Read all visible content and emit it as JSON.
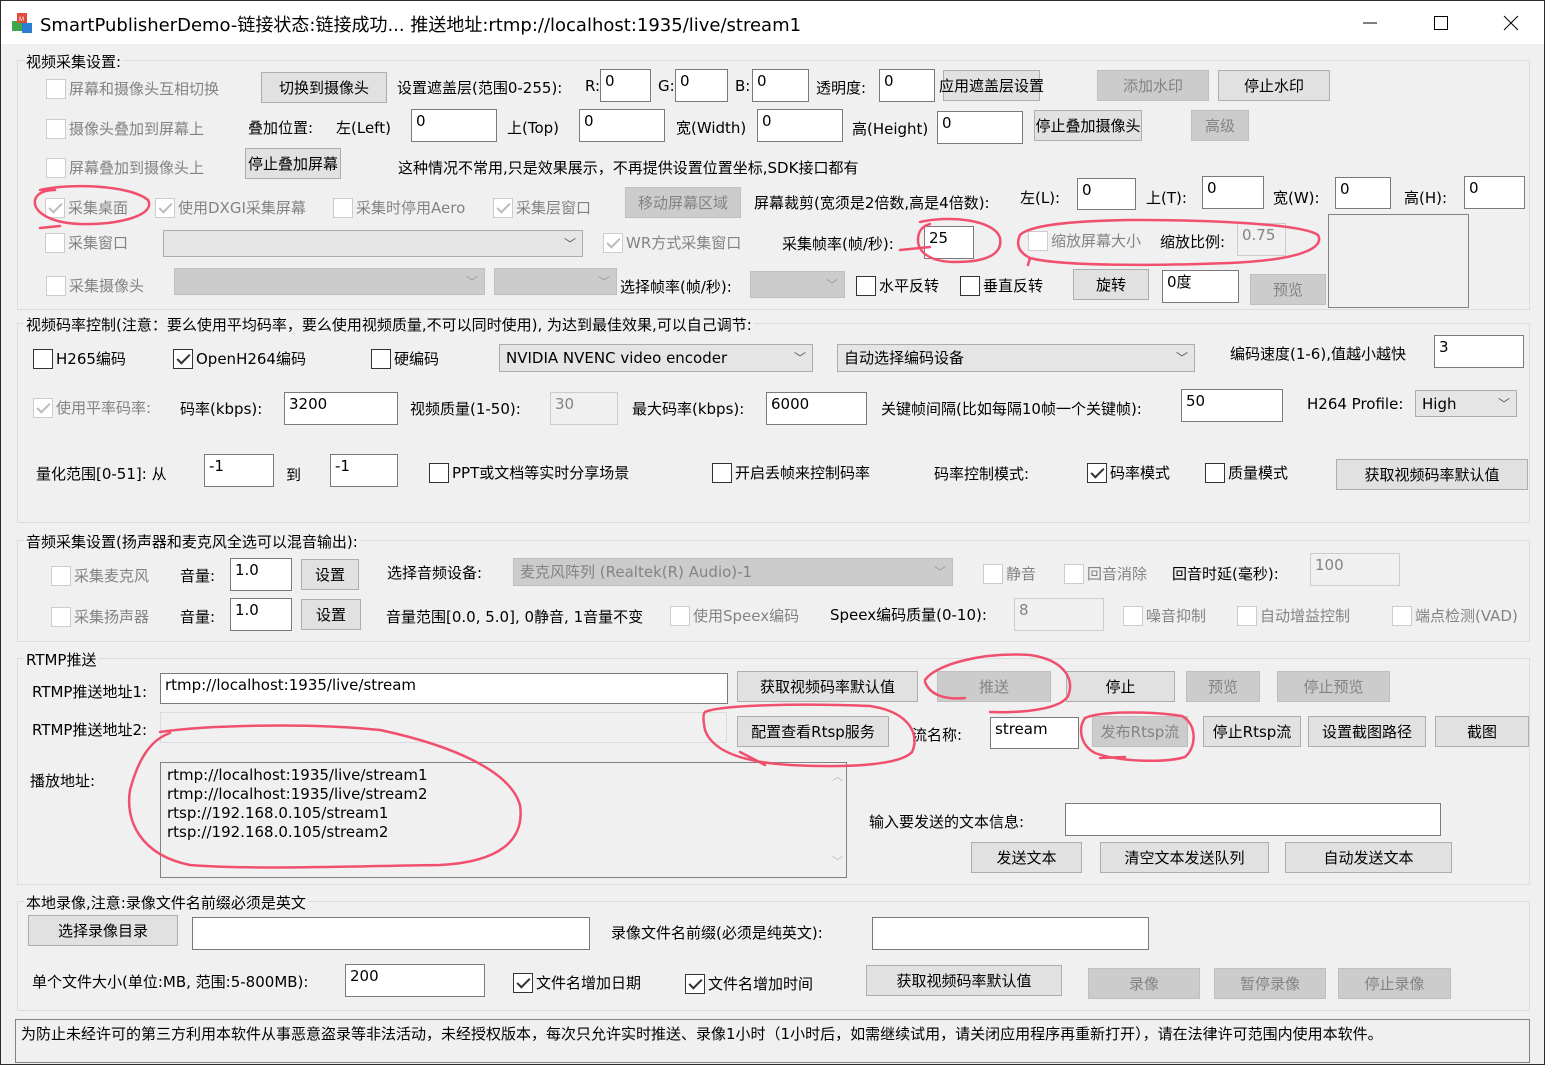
{
  "window": {
    "title": "SmartPublisherDemo-链接状态:链接成功... 推送地址:rtmp://localhost:1935/live/stream1",
    "icon": "app-cubes-icon",
    "controls": {
      "minimize": "minimize-icon",
      "maximize": "maximize-icon",
      "close": "close-icon"
    }
  },
  "video_capture": {
    "group_label": "视频采集设置:",
    "switch_screen_camera": {
      "label": "屏幕和摄像头互相切换",
      "checked": false,
      "enabled": false
    },
    "switch_to_camera_button": "切换到摄像头",
    "mask_label": "设置遮盖层(范围0-255):",
    "r_label": "R:",
    "r_value": "0",
    "g_label": "G:",
    "g_value": "0",
    "b_label": "B:",
    "b_value": "0",
    "alpha_label": "透明度:",
    "alpha_value": "0",
    "apply_mask_button": "应用遮盖层设置",
    "add_watermark_button": "添加水印",
    "stop_watermark_button": "停止水印",
    "camera_overlay_screen": {
      "label": "摄像头叠加到屏幕上",
      "checked": false,
      "enabled": false
    },
    "overlay_pos_label": "叠加位置:",
    "left_label": "左(Left)",
    "left_value": "0",
    "top_label": "上(Top)",
    "top_value": "0",
    "width_label": "宽(Width)",
    "width_value": "0",
    "height_label": "高(Height)",
    "height_value": "0",
    "stop_overlay_camera_button": "停止叠加摄像头",
    "advanced_button": "高级",
    "screen_overlay_camera": {
      "label": "屏幕叠加到摄像头上",
      "checked": false,
      "enabled": false
    },
    "stop_overlay_screen_button": "停止叠加屏幕",
    "overlay_note": "这种情况不常用,只是效果展示，不再提供设置位置坐标,SDK接口都有",
    "capture_desktop": {
      "label": "采集桌面",
      "checked": true,
      "enabled": false
    },
    "use_dxgi": {
      "label": "使用DXGI采集屏幕",
      "checked": true,
      "enabled": false
    },
    "disable_aero": {
      "label": "采集时停用Aero",
      "checked": false,
      "enabled": false
    },
    "capture_layered": {
      "label": "采集层窗口",
      "checked": true,
      "enabled": false
    },
    "move_region_button": "移动屏幕区域",
    "crop_label": "屏幕裁剪(宽须是2倍数,高是4倍数):",
    "crop_left_label": "左(L):",
    "crop_left_value": "0",
    "crop_top_label": "上(T):",
    "crop_top_value": "0",
    "crop_width_label": "宽(W):",
    "crop_width_value": "0",
    "crop_height_label": "高(H):",
    "crop_height_value": "0",
    "capture_window": {
      "label": "采集窗口",
      "checked": false,
      "enabled": false
    },
    "window_select_value": "",
    "wr_capture": {
      "label": "WR方式采集窗口",
      "checked": true,
      "enabled": false
    },
    "fps_label": "采集帧率(帧/秒):",
    "fps_value": "25",
    "scale_screen": {
      "label": "缩放屏幕大小",
      "checked": false,
      "enabled": false
    },
    "scale_ratio_label": "缩放比例:",
    "scale_ratio_value": "0.75",
    "capture_camera": {
      "label": "采集摄像头",
      "checked": false,
      "enabled": false
    },
    "camera_select_value": "",
    "resolution_select_value": "",
    "select_fps_label": "选择帧率(帧/秒):",
    "select_fps_value": "",
    "flip_h": {
      "label": "水平反转",
      "checked": false,
      "enabled": true
    },
    "flip_v": {
      "label": "垂直反转",
      "checked": false,
      "enabled": true
    },
    "rotate_button": "旋转",
    "rotate_value": "0度",
    "preview_button": "预览"
  },
  "bitrate": {
    "group_label": "视频码率控制(注意：要么使用平均码率，要么使用视频质量,不可以同时使用), 为达到最佳效果,可以自己调节:",
    "h265": {
      "label": "H265编码",
      "checked": false,
      "enabled": true
    },
    "openh264": {
      "label": "OpenH264编码",
      "checked": true,
      "enabled": true
    },
    "hw_encode": {
      "label": "硬编码",
      "checked": false,
      "enabled": true
    },
    "encoder_select": "NVIDIA NVENC video encoder",
    "device_select": "自动选择编码设备",
    "speed_label": "编码速度(1-6),值越小越快",
    "speed_value": "3",
    "use_avg_bitrate": {
      "label": "使用平率码率:",
      "checked": true,
      "enabled": false
    },
    "bitrate_label": "码率(kbps):",
    "bitrate_value": "3200",
    "quality_label": "视频质量(1-50):",
    "quality_value": "30",
    "max_bitrate_label": "最大码率(kbps):",
    "max_bitrate_value": "6000",
    "gop_label": "关键帧间隔(比如每隔10帧一个关键帧):",
    "gop_value": "50",
    "profile_label": "H264 Profile:",
    "profile_value": "High",
    "qp_label": "量化范围[0-51]: 从",
    "qp_from": "-1",
    "qp_to_label": "到",
    "qp_to": "-1",
    "ppt_scene": {
      "label": "PPT或文档等实时分享场景",
      "checked": false,
      "enabled": true
    },
    "frame_drop": {
      "label": "开启丢帧来控制码率",
      "checked": false,
      "enabled": true
    },
    "mode_label": "码率控制模式:",
    "bitrate_mode": {
      "label": "码率模式",
      "checked": true,
      "enabled": true
    },
    "quality_mode": {
      "label": "质量模式",
      "checked": false,
      "enabled": true
    },
    "get_default_button": "获取视频码率默认值"
  },
  "audio": {
    "group_label": "音频采集设置(扬声器和麦克风全选可以混音输出):",
    "capture_mic": {
      "label": "采集麦克风",
      "checked": false,
      "enabled": false
    },
    "mic_volume_label": "音量:",
    "mic_volume": "1.0",
    "mic_set_button": "设置",
    "device_label": "选择音频设备:",
    "device_value": "麦克风阵列 (Realtek(R) Audio)-1",
    "mute": {
      "label": "静音",
      "checked": false,
      "enabled": false
    },
    "aec": {
      "label": "回音消除",
      "checked": false,
      "enabled": false
    },
    "echo_delay_label": "回音时延(毫秒):",
    "echo_delay_value": "100",
    "capture_speaker": {
      "label": "采集扬声器",
      "checked": false,
      "enabled": false
    },
    "spk_volume_label": "音量:",
    "spk_volume": "1.0",
    "spk_set_button": "设置",
    "volume_range_note": "音量范围[0.0, 5.0], 0静音, 1音量不变",
    "use_speex": {
      "label": "使用Speex编码",
      "checked": false,
      "enabled": false
    },
    "speex_quality_label": "Speex编码质量(0-10):",
    "speex_quality_value": "8",
    "noise_suppress": {
      "label": "噪音抑制",
      "checked": false,
      "enabled": false
    },
    "agc": {
      "label": "自动增益控制",
      "checked": false,
      "enabled": false
    },
    "vad": {
      "label": "端点检测(VAD)",
      "checked": false,
      "enabled": false
    }
  },
  "rtmp": {
    "group_label": "RTMP推送",
    "url1_label": "RTMP推送地址1:",
    "url1_value": "rtmp://localhost:1935/live/stream",
    "get_default_button": "获取视频码率默认值",
    "push_button": "推送",
    "stop_button": "停止",
    "preview_button": "预览",
    "stop_preview_button": "停止预览",
    "url2_label": "RTMP推送地址2:",
    "url2_value": "",
    "rtsp_config_button": "配置查看Rtsp服务",
    "stream_name_label": "流名称:",
    "stream_name_value": "stream",
    "publish_rtsp_button": "发布Rtsp流",
    "stop_rtsp_button": "停止Rtsp流",
    "snapshot_path_button": "设置截图路径",
    "snapshot_button": "截图",
    "play_urls_label": "播放地址:",
    "play_urls": [
      "rtmp://localhost:1935/live/stream1",
      "rtmp://localhost:1935/live/stream2",
      "rtsp://192.168.0.105/stream1",
      "rtsp://192.168.0.105/stream2"
    ],
    "text_msg_label": "输入要发送的文本信息:",
    "text_msg_value": "",
    "send_text_button": "发送文本",
    "clear_queue_button": "清空文本发送队列",
    "auto_send_button": "自动发送文本"
  },
  "record": {
    "group_label": "本地录像,注意:录像文件名前缀必须是英文",
    "choose_dir_button": "选择录像目录",
    "dir_value": "",
    "prefix_label": "录像文件名前缀(必须是纯英文):",
    "prefix_value": "",
    "file_size_label": "单个文件大小(单位:MB, 范围:5-800MB):",
    "file_size_value": "200",
    "add_date": {
      "label": "文件名增加日期",
      "checked": true,
      "enabled": true
    },
    "add_time": {
      "label": "文件名增加时间",
      "checked": true,
      "enabled": true
    },
    "get_default_button": "获取视频码率默认值",
    "record_button": "录像",
    "pause_button": "暂停录像",
    "stop_button": "停止录像"
  },
  "notice": "为防止未经许可的第三方利用本软件从事恶意盗录等非法活动，未经授权版本，每次只允许实时推送、录像1小时（1小时后，如需继续试用，请关闭应用程序再重新打开），请在法律许可范围内使用本软件。",
  "annotation_color": "#f0506e"
}
